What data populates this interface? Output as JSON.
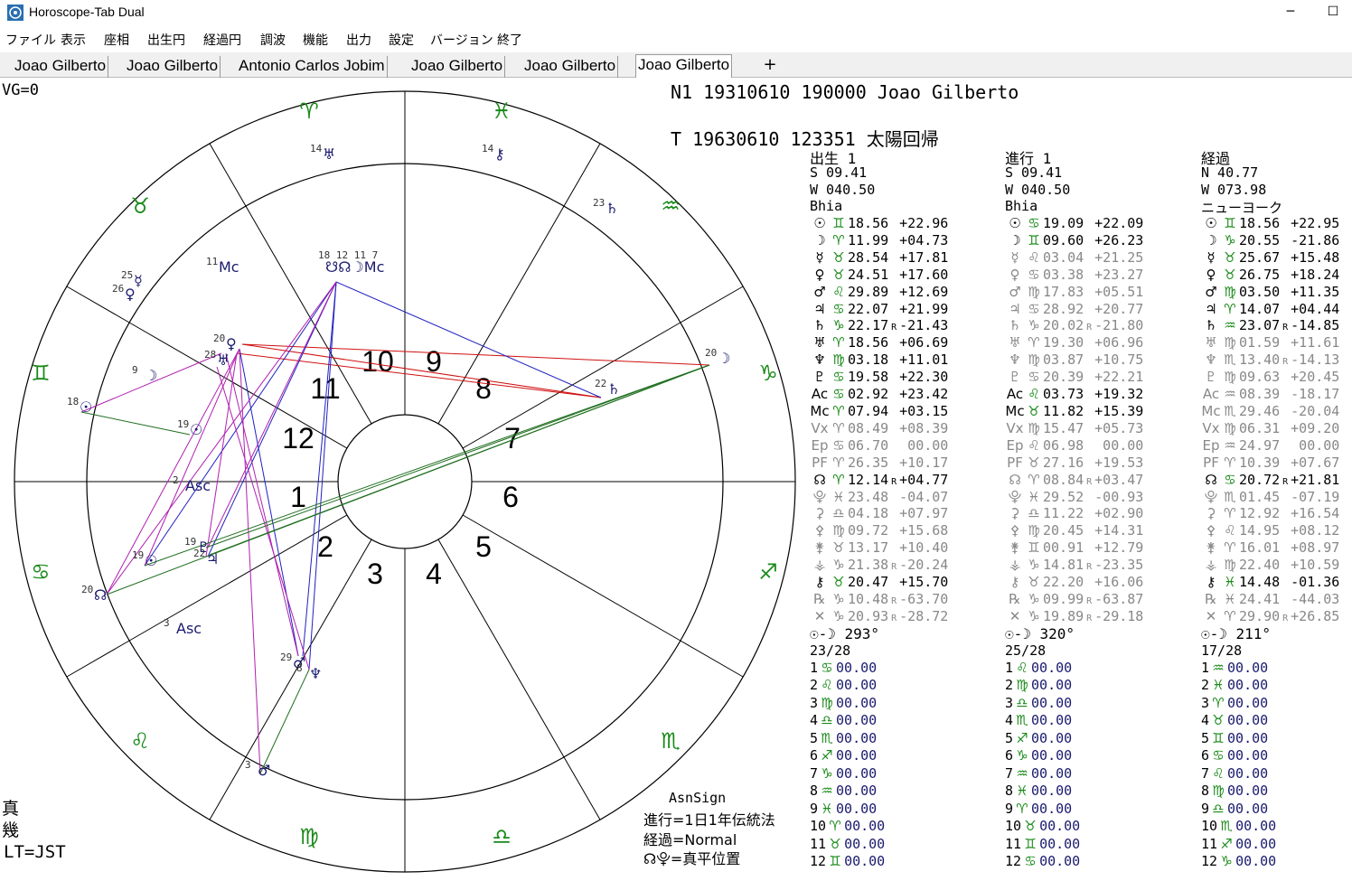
{
  "app": {
    "title": "Horoscope-Tab Dual",
    "minimize": "─",
    "maximize": "☐"
  },
  "menu": [
    "ファイル",
    "表示",
    "座相",
    "出生円",
    "経過円",
    "調波",
    "機能",
    "出力",
    "設定",
    "バージョン",
    "終了"
  ],
  "tabs": [
    "Joao Gilberto",
    "Joao Gilberto",
    "Antonio Carlos Jobim",
    "Joao Gilberto",
    "Joao Gilberto",
    "Joao Gilberto"
  ],
  "active_tab": 5,
  "add_tab": "+",
  "status": {
    "vg": "VG=0",
    "natal": "N1  19310610  190000   Joao Gilberto",
    "transit": "T   19630610  123351   太陽回帰",
    "bottom_left": [
      "真",
      "幾",
      "LT=JST"
    ],
    "methods": [
      "AsnSign",
      "進行=1日1年伝統法",
      "経過=Normal",
      "☊⯓=真平位置"
    ]
  },
  "colors": {
    "sign_green": "#1a8a1a",
    "planet_navy": "#1a1a6e",
    "aspect_red": "#d01010",
    "aspect_blue": "#2020c0",
    "aspect_magenta": "#b020b0",
    "aspect_green": "#1f6e1f",
    "retro_gray": "#888888"
  },
  "chart": {
    "houses": [
      "1",
      "2",
      "3",
      "4",
      "5",
      "6",
      "7",
      "8",
      "9",
      "10",
      "11",
      "12"
    ],
    "signs": [
      "♈",
      "♉",
      "♊",
      "♋",
      "♌",
      "♍",
      "♎",
      "♏",
      "♐",
      "♑",
      "♒",
      "♓"
    ],
    "inner_planets": [
      {
        "g": "☉",
        "d": "18"
      },
      {
        "g": "☉",
        "d": "19"
      },
      {
        "g": "☽",
        "d": "9"
      },
      {
        "g": "♀",
        "d": "26"
      },
      {
        "g": "☿",
        "d": "25"
      },
      {
        "g": "Mc",
        "d": "11"
      },
      {
        "g": "Asc",
        "d": "2"
      },
      {
        "g": "Asc",
        "d": "3"
      },
      {
        "g": "☊",
        "d": "20"
      },
      {
        "g": "☉",
        "d": "19"
      },
      {
        "g": "♂",
        "d": "29"
      },
      {
        "g": "♆",
        "d": "8"
      },
      {
        "g": "♂",
        "d": "3"
      },
      {
        "g": "♅",
        "d": "14"
      },
      {
        "g": "⚷",
        "d": "14"
      },
      {
        "g": "♄",
        "d": "23"
      },
      {
        "g": "☽",
        "d": "20"
      },
      {
        "g": "♄",
        "d": "22"
      },
      {
        "g": "♀",
        "d": "20"
      },
      {
        "g": "♅",
        "d": "28"
      },
      {
        "g": "♇",
        "d": "19"
      },
      {
        "g": "♃",
        "d": "22"
      }
    ],
    "top_cluster": {
      "labels": [
        "18",
        "12",
        "11",
        "7"
      ],
      "glyphs": "☋☊☽Mc"
    }
  },
  "columns": [
    {
      "title": "出生 1",
      "lat": "S  09.41",
      "lon": "W 040.50",
      "house_sys": "Bhia",
      "rows": [
        {
          "p": "☉",
          "s": "♊",
          "v": "18.56",
          "r": "",
          "d": "+22.96",
          "gray": false
        },
        {
          "p": "☽",
          "s": "♈",
          "v": "11.99",
          "r": "",
          "d": "+04.73",
          "gray": false
        },
        {
          "p": "☿",
          "s": "♉",
          "v": "28.54",
          "r": "",
          "d": "+17.81",
          "gray": false
        },
        {
          "p": "♀",
          "s": "♉",
          "v": "24.51",
          "r": "",
          "d": "+17.60",
          "gray": false
        },
        {
          "p": "♂",
          "s": "♌",
          "v": "29.89",
          "r": "",
          "d": "+12.69",
          "gray": false
        },
        {
          "p": "♃",
          "s": "♋",
          "v": "22.07",
          "r": "",
          "d": "+21.99",
          "gray": false
        },
        {
          "p": "♄",
          "s": "♑",
          "v": "22.17",
          "r": "R",
          "d": "-21.43",
          "gray": false
        },
        {
          "p": "♅",
          "s": "♈",
          "v": "18.56",
          "r": "",
          "d": "+06.69",
          "gray": false
        },
        {
          "p": "♆",
          "s": "♍",
          "v": "03.18",
          "r": "",
          "d": "+11.01",
          "gray": false
        },
        {
          "p": "♇",
          "s": "♋",
          "v": "19.58",
          "r": "",
          "d": "+22.30",
          "gray": false
        },
        {
          "p": "Ac",
          "s": "♋",
          "v": "02.92",
          "r": "",
          "d": "+23.42",
          "gray": false
        },
        {
          "p": "Mc",
          "s": "♈",
          "v": "07.94",
          "r": "",
          "d": "+03.15",
          "gray": false
        },
        {
          "p": "Vx",
          "s": "♈",
          "v": "08.49",
          "r": "",
          "d": "+08.39",
          "gray": true
        },
        {
          "p": "Ep",
          "s": "♋",
          "v": "06.70",
          "r": "",
          "d": " 00.00",
          "gray": true
        },
        {
          "p": "PF",
          "s": "♈",
          "v": "26.35",
          "r": "",
          "d": "+10.17",
          "gray": true
        },
        {
          "p": "☊",
          "s": "♈",
          "v": "12.14",
          "r": "R",
          "d": "+04.77",
          "gray": false
        },
        {
          "p": "⯓",
          "s": "♓",
          "v": "23.48",
          "r": "",
          "d": "-04.07",
          "gray": true
        },
        {
          "p": "⚳",
          "s": "♎",
          "v": "04.18",
          "r": "",
          "d": "+07.97",
          "gray": true
        },
        {
          "p": "⚴",
          "s": "♍",
          "v": "09.72",
          "r": "",
          "d": "+15.68",
          "gray": true
        },
        {
          "p": "⚵",
          "s": "♉",
          "v": "13.17",
          "r": "",
          "d": "+10.40",
          "gray": true
        },
        {
          "p": "⚶",
          "s": "♑",
          "v": "21.38",
          "r": "R",
          "d": "-20.24",
          "gray": true
        },
        {
          "p": "⚷",
          "s": "♉",
          "v": "20.47",
          "r": "",
          "d": "+15.70",
          "gray": false
        },
        {
          "p": "℞",
          "s": "♑",
          "v": "10.48",
          "r": "R",
          "d": "-63.70",
          "gray": true
        },
        {
          "p": "✕",
          "s": "♑",
          "v": "20.93",
          "r": "R",
          "d": "-28.72",
          "gray": true
        }
      ],
      "phase": "☉-☽  293°",
      "phase_day": "23/28",
      "houses": [
        {
          "n": " 1",
          "s": "♋",
          "v": "00.00"
        },
        {
          "n": " 2",
          "s": "♌",
          "v": "00.00"
        },
        {
          "n": " 3",
          "s": "♍",
          "v": "00.00"
        },
        {
          "n": " 4",
          "s": "♎",
          "v": "00.00"
        },
        {
          "n": " 5",
          "s": "♏",
          "v": "00.00"
        },
        {
          "n": " 6",
          "s": "♐",
          "v": "00.00"
        },
        {
          "n": " 7",
          "s": "♑",
          "v": "00.00"
        },
        {
          "n": " 8",
          "s": "♒",
          "v": "00.00"
        },
        {
          "n": " 9",
          "s": "♓",
          "v": "00.00"
        },
        {
          "n": "10",
          "s": "♈",
          "v": "00.00"
        },
        {
          "n": "11",
          "s": "♉",
          "v": "00.00"
        },
        {
          "n": "12",
          "s": "♊",
          "v": "00.00"
        }
      ]
    },
    {
      "title": "進行 1",
      "lat": "S  09.41",
      "lon": "W 040.50",
      "house_sys": "Bhia",
      "rows": [
        {
          "p": "☉",
          "s": "♋",
          "v": "19.09",
          "r": "",
          "d": "+22.09",
          "gray": false
        },
        {
          "p": "☽",
          "s": "♊",
          "v": "09.60",
          "r": "",
          "d": "+26.23",
          "gray": false
        },
        {
          "p": "☿",
          "s": "♌",
          "v": "03.04",
          "r": "",
          "d": "+21.25",
          "gray": true
        },
        {
          "p": "♀",
          "s": "♋",
          "v": "03.38",
          "r": "",
          "d": "+23.27",
          "gray": true
        },
        {
          "p": "♂",
          "s": "♍",
          "v": "17.83",
          "r": "",
          "d": "+05.51",
          "gray": true
        },
        {
          "p": "♃",
          "s": "♋",
          "v": "28.92",
          "r": "",
          "d": "+20.77",
          "gray": true
        },
        {
          "p": "♄",
          "s": "♑",
          "v": "20.02",
          "r": "R",
          "d": "-21.80",
          "gray": true
        },
        {
          "p": "♅",
          "s": "♈",
          "v": "19.30",
          "r": "",
          "d": "+06.96",
          "gray": true
        },
        {
          "p": "♆",
          "s": "♍",
          "v": "03.87",
          "r": "",
          "d": "+10.75",
          "gray": true
        },
        {
          "p": "♇",
          "s": "♋",
          "v": "20.39",
          "r": "",
          "d": "+22.21",
          "gray": true
        },
        {
          "p": "Ac",
          "s": "♌",
          "v": "03.73",
          "r": "",
          "d": "+19.32",
          "gray": false
        },
        {
          "p": "Mc",
          "s": "♉",
          "v": "11.82",
          "r": "",
          "d": "+15.39",
          "gray": false
        },
        {
          "p": "Vx",
          "s": "♍",
          "v": "15.47",
          "r": "",
          "d": "+05.73",
          "gray": true
        },
        {
          "p": "Ep",
          "s": "♌",
          "v": "06.98",
          "r": "",
          "d": " 00.00",
          "gray": true
        },
        {
          "p": "PF",
          "s": "♉",
          "v": "27.16",
          "r": "",
          "d": "+19.53",
          "gray": true
        },
        {
          "p": "☊",
          "s": "♈",
          "v": "08.84",
          "r": "R",
          "d": "+03.47",
          "gray": true
        },
        {
          "p": "⯓",
          "s": "♓",
          "v": "29.52",
          "r": "",
          "d": "-00.93",
          "gray": true
        },
        {
          "p": "⚳",
          "s": "♎",
          "v": "11.22",
          "r": "",
          "d": "+02.90",
          "gray": true
        },
        {
          "p": "⚴",
          "s": "♍",
          "v": "20.45",
          "r": "",
          "d": "+14.31",
          "gray": true
        },
        {
          "p": "⚵",
          "s": "♊",
          "v": "00.91",
          "r": "",
          "d": "+12.79",
          "gray": true
        },
        {
          "p": "⚶",
          "s": "♑",
          "v": "14.81",
          "r": "R",
          "d": "-23.35",
          "gray": true
        },
        {
          "p": "⚷",
          "s": "♉",
          "v": "22.20",
          "r": "",
          "d": "+16.06",
          "gray": true
        },
        {
          "p": "℞",
          "s": "♑",
          "v": "09.99",
          "r": "R",
          "d": "-63.87",
          "gray": true
        },
        {
          "p": "✕",
          "s": "♑",
          "v": "19.89",
          "r": "R",
          "d": "-29.18",
          "gray": true
        }
      ],
      "phase": "☉-☽  320°",
      "phase_day": "25/28",
      "houses": [
        {
          "n": " 1",
          "s": "♌",
          "v": "00.00"
        },
        {
          "n": " 2",
          "s": "♍",
          "v": "00.00"
        },
        {
          "n": " 3",
          "s": "♎",
          "v": "00.00"
        },
        {
          "n": " 4",
          "s": "♏",
          "v": "00.00"
        },
        {
          "n": " 5",
          "s": "♐",
          "v": "00.00"
        },
        {
          "n": " 6",
          "s": "♑",
          "v": "00.00"
        },
        {
          "n": " 7",
          "s": "♒",
          "v": "00.00"
        },
        {
          "n": " 8",
          "s": "♓",
          "v": "00.00"
        },
        {
          "n": " 9",
          "s": "♈",
          "v": "00.00"
        },
        {
          "n": "10",
          "s": "♉",
          "v": "00.00"
        },
        {
          "n": "11",
          "s": "♊",
          "v": "00.00"
        },
        {
          "n": "12",
          "s": "♋",
          "v": "00.00"
        }
      ]
    },
    {
      "title": "経過",
      "lat": "N  40.77",
      "lon": "W 073.98",
      "house_sys": "ニューヨーク",
      "rows": [
        {
          "p": "☉",
          "s": "♊",
          "v": "18.56",
          "r": "",
          "d": "+22.95",
          "gray": false
        },
        {
          "p": "☽",
          "s": "♑",
          "v": "20.55",
          "r": "",
          "d": "-21.86",
          "gray": false
        },
        {
          "p": "☿",
          "s": "♉",
          "v": "25.67",
          "r": "",
          "d": "+15.48",
          "gray": false
        },
        {
          "p": "♀",
          "s": "♉",
          "v": "26.75",
          "r": "",
          "d": "+18.24",
          "gray": false
        },
        {
          "p": "♂",
          "s": "♍",
          "v": "03.50",
          "r": "",
          "d": "+11.35",
          "gray": false
        },
        {
          "p": "♃",
          "s": "♈",
          "v": "14.07",
          "r": "",
          "d": "+04.44",
          "gray": false
        },
        {
          "p": "♄",
          "s": "♒",
          "v": "23.07",
          "r": "R",
          "d": "-14.85",
          "gray": false
        },
        {
          "p": "♅",
          "s": "♍",
          "v": "01.59",
          "r": "",
          "d": "+11.61",
          "gray": true
        },
        {
          "p": "♆",
          "s": "♏",
          "v": "13.40",
          "r": "R",
          "d": "-14.13",
          "gray": true
        },
        {
          "p": "♇",
          "s": "♍",
          "v": "09.63",
          "r": "",
          "d": "+20.45",
          "gray": true
        },
        {
          "p": "Ac",
          "s": "♒",
          "v": "08.39",
          "r": "",
          "d": "-18.17",
          "gray": true
        },
        {
          "p": "Mc",
          "s": "♏",
          "v": "29.46",
          "r": "",
          "d": "-20.04",
          "gray": true
        },
        {
          "p": "Vx",
          "s": "♍",
          "v": "06.31",
          "r": "",
          "d": "+09.20",
          "gray": true
        },
        {
          "p": "Ep",
          "s": "♒",
          "v": "24.97",
          "r": "",
          "d": " 00.00",
          "gray": true
        },
        {
          "p": "PF",
          "s": "♈",
          "v": "10.39",
          "r": "",
          "d": "+07.67",
          "gray": true
        },
        {
          "p": "☊",
          "s": "♋",
          "v": "20.72",
          "r": "R",
          "d": "+21.81",
          "gray": false
        },
        {
          "p": "⯓",
          "s": "♏",
          "v": "01.45",
          "r": "",
          "d": "-07.19",
          "gray": true
        },
        {
          "p": "⚳",
          "s": "♈",
          "v": "12.92",
          "r": "",
          "d": "+16.54",
          "gray": true
        },
        {
          "p": "⚴",
          "s": "♌",
          "v": "14.95",
          "r": "",
          "d": "+08.12",
          "gray": true
        },
        {
          "p": "⚵",
          "s": "♈",
          "v": "16.01",
          "r": "",
          "d": "+08.97",
          "gray": true
        },
        {
          "p": "⚶",
          "s": "♍",
          "v": "22.40",
          "r": "",
          "d": "+10.59",
          "gray": true
        },
        {
          "p": "⚷",
          "s": "♓",
          "v": "14.48",
          "r": "",
          "d": "-01.36",
          "gray": false
        },
        {
          "p": "℞",
          "s": "♓",
          "v": "24.41",
          "r": "",
          "d": "-44.03",
          "gray": true
        },
        {
          "p": "✕",
          "s": "♈",
          "v": "29.90",
          "r": "R",
          "d": "+26.85",
          "gray": true
        }
      ],
      "phase": "☉-☽  211°",
      "phase_day": "17/28",
      "houses": [
        {
          "n": " 1",
          "s": "♒",
          "v": "00.00"
        },
        {
          "n": " 2",
          "s": "♓",
          "v": "00.00"
        },
        {
          "n": " 3",
          "s": "♈",
          "v": "00.00"
        },
        {
          "n": " 4",
          "s": "♉",
          "v": "00.00"
        },
        {
          "n": " 5",
          "s": "♊",
          "v": "00.00"
        },
        {
          "n": " 6",
          "s": "♋",
          "v": "00.00"
        },
        {
          "n": " 7",
          "s": "♌",
          "v": "00.00"
        },
        {
          "n": " 8",
          "s": "♍",
          "v": "00.00"
        },
        {
          "n": " 9",
          "s": "♎",
          "v": "00.00"
        },
        {
          "n": "10",
          "s": "♏",
          "v": "00.00"
        },
        {
          "n": "11",
          "s": "♐",
          "v": "00.00"
        },
        {
          "n": "12",
          "s": "♑",
          "v": "00.00"
        }
      ]
    }
  ]
}
